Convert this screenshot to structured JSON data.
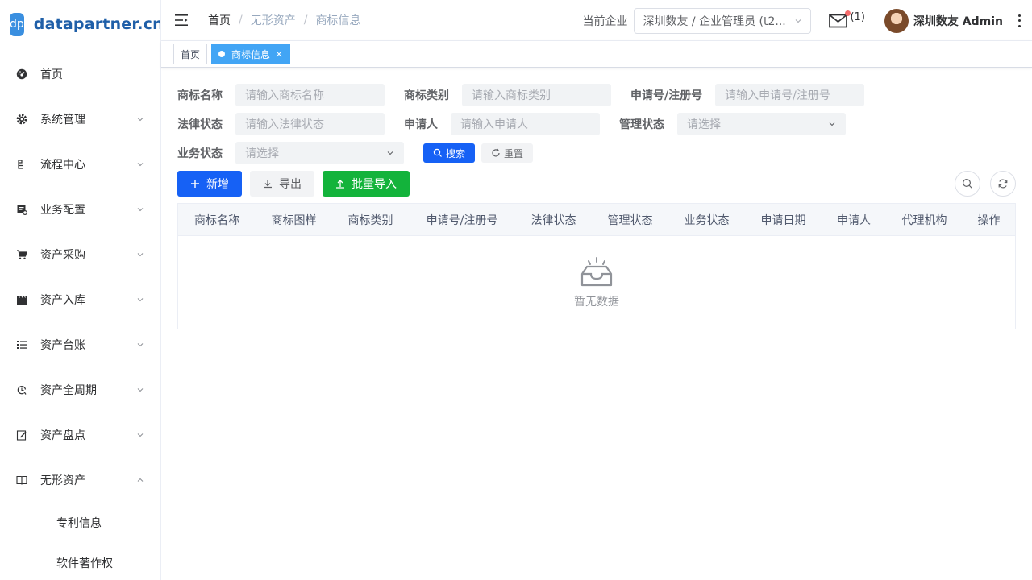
{
  "brand": {
    "badge": "dp",
    "name": "datapartner.cn"
  },
  "sidebar": {
    "items": [
      {
        "label": "首页"
      },
      {
        "label": "系统管理"
      },
      {
        "label": "流程中心"
      },
      {
        "label": "业务配置"
      },
      {
        "label": "资产采购"
      },
      {
        "label": "资产入库"
      },
      {
        "label": "资产台账"
      },
      {
        "label": "资产全周期"
      },
      {
        "label": "资产盘点"
      },
      {
        "label": "无形资产"
      }
    ],
    "subitems": [
      {
        "label": "专利信息"
      },
      {
        "label": "软件著作权"
      }
    ]
  },
  "header": {
    "breadcrumb": [
      "首页",
      "无形资产",
      "商标信息"
    ],
    "company_label": "当前企业",
    "company_value": "深圳数友 / 企业管理员 (t2...",
    "mail_count": "(1)",
    "user_name": "深圳数友 Admin"
  },
  "tags": [
    {
      "label": "首页"
    },
    {
      "label": "商标信息",
      "close": "×"
    }
  ],
  "search": {
    "trademark_name": {
      "label": "商标名称",
      "placeholder": "请输入商标名称"
    },
    "trademark_category": {
      "label": "商标类别",
      "placeholder": "请输入商标类别"
    },
    "app_reg_no": {
      "label": "申请号/注册号",
      "placeholder": "请输入申请号/注册号"
    },
    "legal_status": {
      "label": "法律状态",
      "placeholder": "请输入法律状态"
    },
    "applicant": {
      "label": "申请人",
      "placeholder": "请输入申请人"
    },
    "mgmt_status": {
      "label": "管理状态",
      "placeholder": "请选择"
    },
    "biz_status": {
      "label": "业务状态",
      "placeholder": "请选择"
    },
    "search_btn": "搜索",
    "reset_btn": "重置"
  },
  "toolbar": {
    "add": "新增",
    "export": "导出",
    "import": "批量导入"
  },
  "table": {
    "columns": [
      "商标名称",
      "商标图样",
      "商标类别",
      "申请号/注册号",
      "法律状态",
      "管理状态",
      "业务状态",
      "申请日期",
      "申请人",
      "代理机构",
      "操作"
    ],
    "empty_text": "暂无数据"
  },
  "colors": {
    "primary": "#1661f5",
    "success": "#13b33b",
    "tag_active": "#42a5f5",
    "brand": "#3a8fe0"
  }
}
